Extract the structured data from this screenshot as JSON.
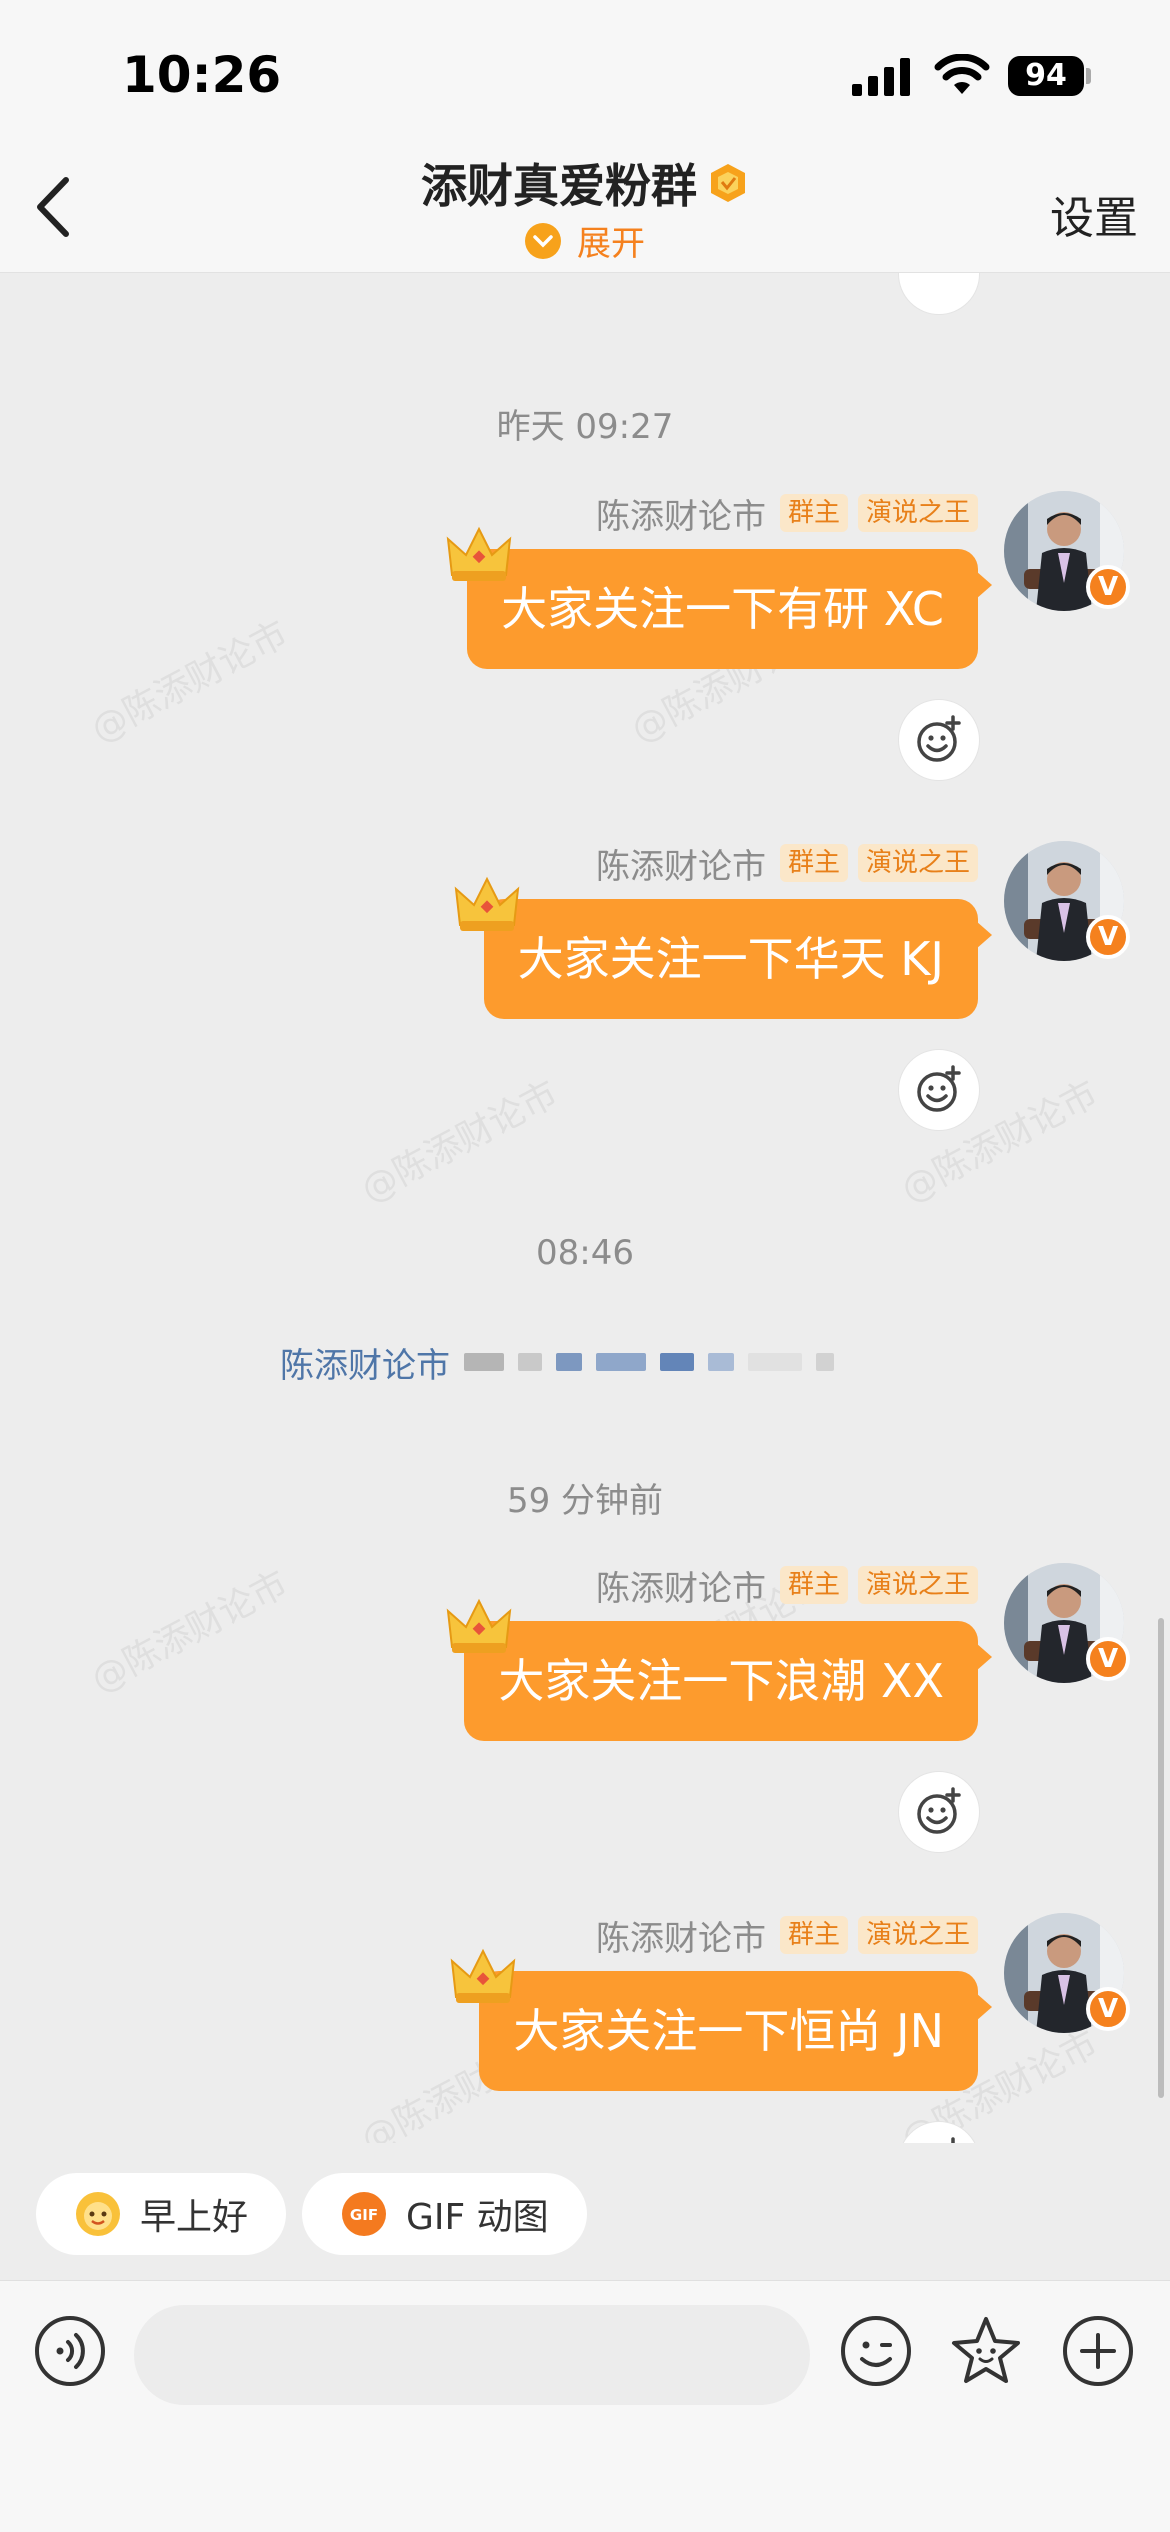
{
  "status_bar": {
    "time": "10:26",
    "battery": "94"
  },
  "header": {
    "title": "添财真爱粉群",
    "subtitle": "展开",
    "settings_label": "设置"
  },
  "chat": {
    "timestamps": [
      "昨天 09:27",
      "08:46",
      "59 分钟前"
    ],
    "messages": [
      {
        "sender": "陈添财论市",
        "tags": [
          "群主",
          "演说之王"
        ],
        "text": "大家关注一下有研 XC"
      },
      {
        "sender": "陈添财论市",
        "tags": [
          "群主",
          "演说之王"
        ],
        "text": "大家关注一下华天 KJ"
      },
      {
        "sender": "陈添财论市",
        "tags": [
          "群主",
          "演说之王"
        ],
        "text": "大家关注一下浪潮 XX"
      },
      {
        "sender": "陈添财论市",
        "tags": [
          "群主",
          "演说之王"
        ],
        "text": "大家关注一下恒尚 JN"
      }
    ],
    "notice": {
      "sender": "陈添财论市"
    },
    "watermark": "@陈添财论市"
  },
  "quick_replies": [
    {
      "icon": "sun-face-icon",
      "label": "早上好"
    },
    {
      "icon": "gif-icon",
      "label": "GIF 动图"
    }
  ],
  "input": {
    "value": "",
    "placeholder": ""
  },
  "colors": {
    "accent": "#fd9b2d",
    "tag_text": "#e8801a",
    "link_blue": "#4f76a8"
  }
}
